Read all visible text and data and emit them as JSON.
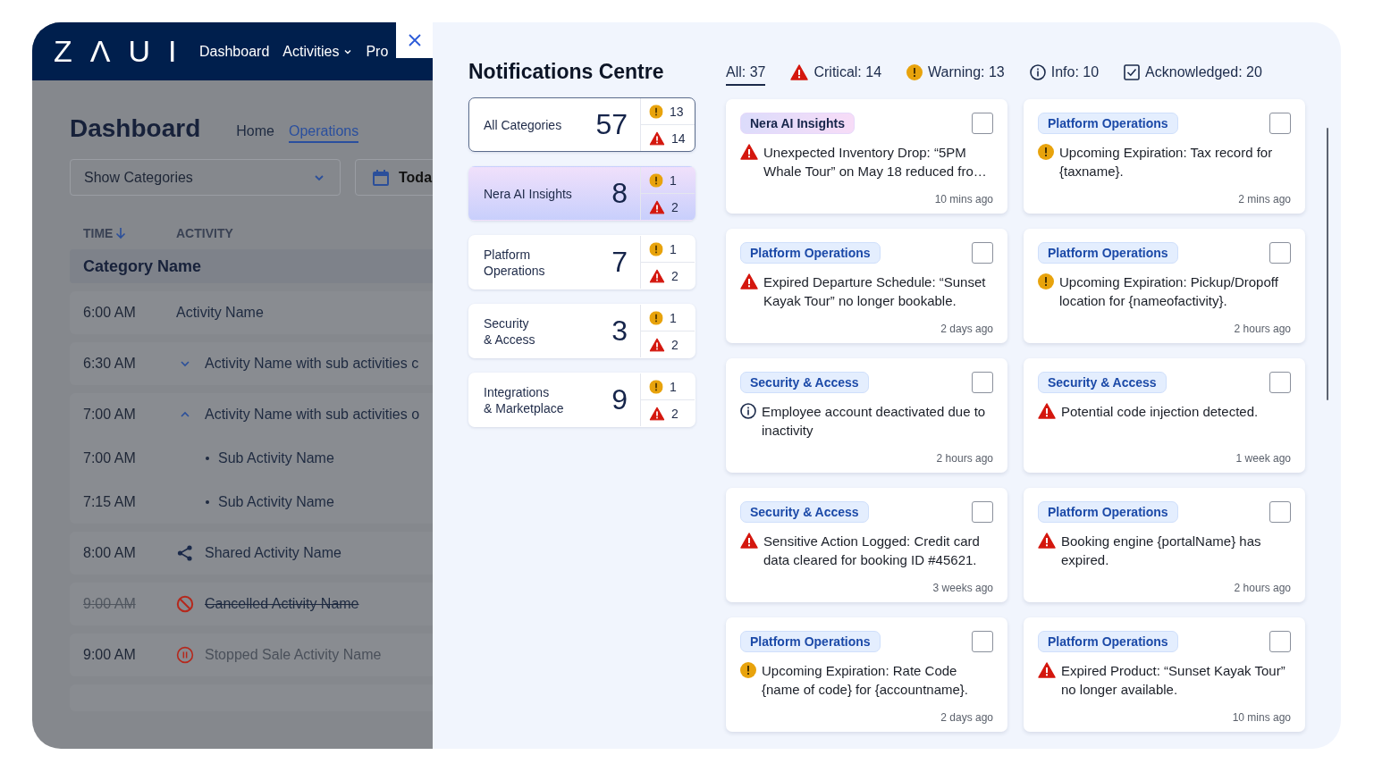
{
  "header": {
    "logo": "ZΛUI",
    "nav": [
      {
        "label": "Dashboard",
        "has_menu": false
      },
      {
        "label": "Activities",
        "has_menu": true
      },
      {
        "label": "Pro",
        "has_menu": false
      }
    ]
  },
  "dashboard": {
    "title": "Dashboard",
    "tabs": [
      {
        "label": "Home",
        "selected": false
      },
      {
        "label": "Operations",
        "selected": true
      }
    ],
    "category_select": {
      "value": "Show Categories"
    },
    "date_button": {
      "label": "Toda"
    },
    "columns": [
      {
        "label": "TIME",
        "sorted": true
      },
      {
        "label": "ACTIVITY",
        "sorted": false
      }
    ],
    "category": "Category Name",
    "rows": [
      {
        "time": "6:00 AM",
        "name": "Activity Name",
        "kind": "plain"
      },
      {
        "time": "6:30 AM",
        "name": "Activity Name with sub activities c",
        "kind": "group",
        "expanded": false
      },
      {
        "time": "7:00 AM",
        "name": "Activity Name with sub activities o",
        "kind": "group",
        "expanded": true,
        "children": [
          {
            "time": "7:00 AM",
            "name": "Sub Activity Name"
          },
          {
            "time": "7:15 AM",
            "name": "Sub Activity Name"
          }
        ]
      },
      {
        "time": "8:00 AM",
        "name": "Shared Activity Name",
        "kind": "shared"
      },
      {
        "time": "9:00 AM",
        "name": "Cancelled Activity Name",
        "kind": "cancelled"
      },
      {
        "time": "9:00 AM",
        "name": "Stopped Sale Activity Name",
        "kind": "stopped"
      }
    ]
  },
  "notifications_centre": {
    "title": "Notifications Centre",
    "filters": [
      {
        "label": "All: 37",
        "kind": "all",
        "selected": true
      },
      {
        "label": "Critical: 14",
        "kind": "critical",
        "selected": false
      },
      {
        "label": "Warning: 13",
        "kind": "warning",
        "selected": false
      },
      {
        "label": "Info: 10",
        "kind": "info",
        "selected": false
      },
      {
        "label": "Acknowledged: 20",
        "kind": "acknowledged",
        "selected": false
      }
    ],
    "categories": [
      {
        "label": "All Categories",
        "count": "57",
        "warning": "13",
        "critical": "14",
        "kind": "standard",
        "selected": true
      },
      {
        "label": "Nera AI Insights",
        "count": "8",
        "warning": "1",
        "critical": "2",
        "kind": "ai",
        "selected": false
      },
      {
        "label": "Platform\nOperations",
        "count": "7",
        "warning": "1",
        "critical": "2",
        "kind": "standard",
        "selected": false
      },
      {
        "label": "Security\n& Access",
        "count": "3",
        "warning": "1",
        "critical": "2",
        "kind": "standard",
        "selected": false
      },
      {
        "label": "Integrations\n& Marketplace",
        "count": "9",
        "warning": "1",
        "critical": "2",
        "kind": "standard",
        "selected": false
      }
    ],
    "notifications": [
      {
        "tag": {
          "label": "Nera AI Insights",
          "kind": "ai"
        },
        "kind": "critical",
        "message": "Unexpected Inventory Drop: “5PM Whale Tour” on May 18 reduced fro…",
        "time": "10 mins ago",
        "checked": false
      },
      {
        "tag": {
          "label": "Platform Operations",
          "kind": "standard"
        },
        "kind": "warning",
        "message": "Upcoming Expiration: Tax record for {taxname}.",
        "time": "2 mins ago",
        "checked": false
      },
      {
        "tag": {
          "label": "Platform Operations",
          "kind": "standard"
        },
        "kind": "critical",
        "message": "Expired Departure Schedule: “Sunset Kayak Tour” no longer bookable.",
        "time": "2 days ago",
        "checked": false
      },
      {
        "tag": {
          "label": "Platform Operations",
          "kind": "standard"
        },
        "kind": "warning",
        "message": "Upcoming Expiration: Pickup/Dropoff location for {nameofactivity}.",
        "time": "2 hours ago",
        "checked": false
      },
      {
        "tag": {
          "label": "Security & Access",
          "kind": "standard"
        },
        "kind": "info",
        "message": "Employee account deactivated due to inactivity",
        "time": "2 hours ago",
        "checked": false
      },
      {
        "tag": {
          "label": "Security & Access",
          "kind": "standard"
        },
        "kind": "critical",
        "message": "Potential code injection detected.",
        "time": "1 week ago",
        "checked": false
      },
      {
        "tag": {
          "label": "Security & Access",
          "kind": "standard"
        },
        "kind": "critical",
        "message": "Sensitive Action Logged: Credit card data cleared for booking ID #45621.",
        "time": "3 weeks ago",
        "checked": false
      },
      {
        "tag": {
          "label": "Platform Operations",
          "kind": "standard"
        },
        "kind": "critical",
        "message": "Booking engine {portalName} has expired.",
        "time": "2 hours ago",
        "checked": false
      },
      {
        "tag": {
          "label": "Platform Operations",
          "kind": "standard"
        },
        "kind": "warning",
        "message": "Upcoming Expiration: Rate Code {name of code} for {accountname}.",
        "time": "2 days ago",
        "checked": false
      },
      {
        "tag": {
          "label": "Platform Operations",
          "kind": "standard"
        },
        "kind": "critical",
        "message": "Expired Product: “Sunset Kayak Tour” no longer available.",
        "time": "10 mins ago",
        "checked": false
      }
    ]
  }
}
